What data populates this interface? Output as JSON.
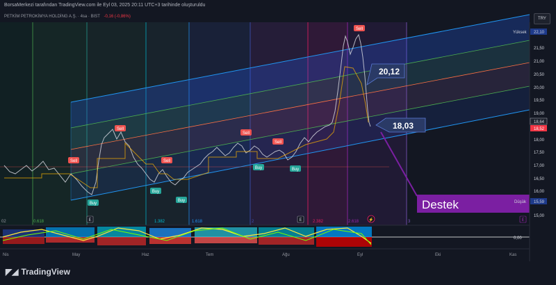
{
  "header": {
    "attribution": "BorsaMerkezi tarafından TradingView.com ile Eyl 03, 2025 20:11 UTC+3 tarihinde oluşturuldu"
  },
  "symbol": {
    "name": "PETKİM PETROKİMYA HOLDİNG A.Ş. · 4sa · BIST",
    "change": "-0,16 (-0,86%)"
  },
  "currency": "TRY",
  "price_axis": {
    "ticks": [
      "22,10",
      "21,50",
      "21,00",
      "20,50",
      "20,00",
      "19,50",
      "19,00",
      "18,64",
      "18,52",
      "18,00",
      "17,50",
      "17,00",
      "16,50",
      "16,00",
      "15,59",
      "15,00"
    ],
    "high_label": "Yüksek",
    "low_label": "Düşük",
    "high_value": "22,10",
    "low_value": "15,59",
    "last_price": "18,64",
    "prev_price": "18,52"
  },
  "annotations": {
    "resistance_price": "20,12",
    "support_price": "18,03",
    "support_label": "Destek"
  },
  "fib_labels": [
    "0.618",
    "1",
    "1.382",
    "1.618",
    "2",
    "2.382",
    "2.618",
    "3"
  ],
  "signals": [
    "Sell",
    "Sell",
    "Sell",
    "Sell",
    "Sell",
    "Sell",
    "Buy",
    "Buy",
    "Buy",
    "Buy",
    "Buy"
  ],
  "oscillator": {
    "value": "0,00"
  },
  "time_axis": {
    "labels": [
      "Nis",
      "May",
      "Haz",
      "Tem",
      "Ağu",
      "Eyl",
      "Eki",
      "Kas"
    ]
  },
  "branding": {
    "name": "TradingView"
  },
  "colors": {
    "background": "#131722",
    "up": "#26a69a",
    "down": "#ef5350",
    "channel_blue": "#2962ff",
    "support": "#7b1fa2"
  }
}
